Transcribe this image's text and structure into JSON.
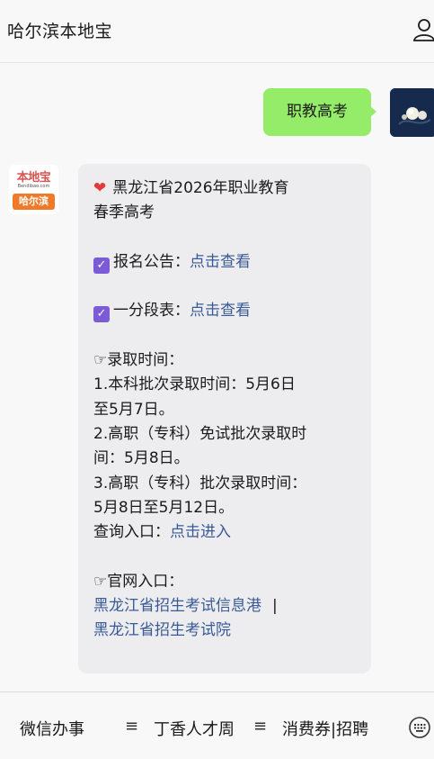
{
  "header": {
    "title": "哈尔滨本地宝",
    "profile_icon": "person-icon"
  },
  "conversation": {
    "user_message": "职教高考",
    "bot_avatar": {
      "top_text": "本地宝",
      "url_text": "Bendibao.com",
      "bottom_text": "哈尔滨"
    },
    "reply": {
      "title_line1": "黑龙江省2026年职业教育",
      "title_line2": "春季高考",
      "registration_label": "报名公告：",
      "registration_link": "点击查看",
      "score_label": "一分段表：",
      "score_link": "点击查看",
      "admission_heading": "☞录取时间：",
      "admission_line1": "1.本科批次录取时间：5月6日",
      "admission_line2": "至5月7日。",
      "admission_line3": "2.高职（专科）免试批次录取时",
      "admission_line4": "间：5月8日。",
      "admission_line5": "3.高职（专科）批次录取时间：",
      "admission_line6": "5月8日至5月12日。",
      "query_label": "查询入口：",
      "query_link": "点击进入",
      "official_heading": "☞官网入口：",
      "official_link1": "黑龙江省招生考试信息港",
      "separator": "|",
      "official_link2": "黑龙江省招生考试院"
    }
  },
  "bottom_menu": {
    "item1": "微信办事",
    "item2": "丁香人才周",
    "item3": "消费券|招聘",
    "menu_icon": "hamburger-icon",
    "keyboard_icon": "keyboard-icon"
  }
}
